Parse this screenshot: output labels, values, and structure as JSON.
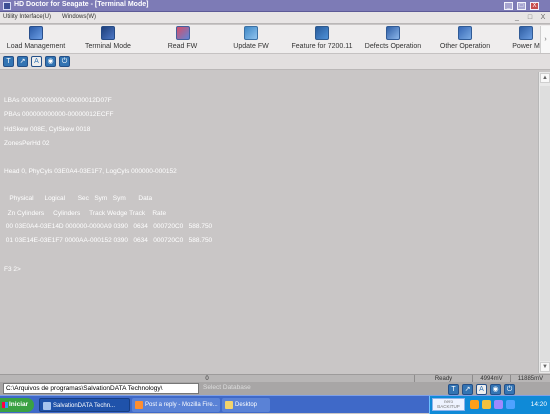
{
  "window": {
    "title": "HD Doctor for Seagate - [Terminal Mode]",
    "controls": [
      "_",
      "□",
      "X"
    ]
  },
  "menubar": {
    "items": [
      "Utility Interface(U)",
      "Windows(W)"
    ],
    "right_controls": [
      "_",
      "□",
      "X"
    ]
  },
  "toolbar": {
    "items": [
      {
        "label": "Load Management",
        "icon": "load-management-icon"
      },
      {
        "label": "Terminal Mode",
        "icon": "terminal-mode-icon"
      },
      {
        "label": "Read FW",
        "icon": "read-fw-icon"
      },
      {
        "label": "Update FW",
        "icon": "update-fw-icon"
      },
      {
        "label": "Feature for 7200.11",
        "icon": "feature-icon"
      },
      {
        "label": "Defects Operation",
        "icon": "defects-operation-icon"
      },
      {
        "label": "Other Operation",
        "icon": "other-operation-icon"
      },
      {
        "label": "Power M",
        "icon": "power-management-icon"
      }
    ],
    "scroll_arrow": "›"
  },
  "subtoolbar": {
    "buttons": [
      {
        "label": "T",
        "icon": "t-icon"
      },
      {
        "label": "↗",
        "icon": "arrow-icon"
      },
      {
        "label": "A",
        "icon": "a-icon"
      },
      {
        "label": "◉",
        "icon": "record-icon"
      },
      {
        "label": "⏻",
        "icon": "power-icon"
      }
    ]
  },
  "terminal": {
    "lines": [
      "LBAs 000000000000-00000012D07F",
      "PBAs 000000000000-00000012ECFF",
      "HdSkew 008E, CylSkew 0018",
      "ZonesPerHd 02",
      "",
      "Head 0, PhyCyls 03E0A4-03E1F7, LogCyls 000000-000152",
      "",
      "   Physical      Logical       Sec   Sym   Sym       Data",
      "  Zn Cylinders     Cylinders     Track Wedge Track    Rate",
      " 00 03E0A4-03E14D 000000-0000A9 0390   0634   000720C0   588.750",
      " 01 03E14E-03E1F7 0000AA-000152 0390   0634   000720C0   588.750",
      "",
      "F3 2>"
    ]
  },
  "scrollbar": {
    "up": "▲",
    "down": "▼"
  },
  "status": {
    "counter": "0",
    "ready": "Ready",
    "voltage_1": "4994mV",
    "voltage_2": "11885mV"
  },
  "command": {
    "path": "C:\\Arquivos de programas\\SalvationDATA Technology\\",
    "select_database": "Select Database",
    "buttons": [
      "T",
      "↗",
      "A",
      "◉",
      "⏻"
    ]
  },
  "taskbar": {
    "start": "Iniciar",
    "tasks": [
      {
        "label": "SalvationDATA Techn...",
        "icon": "app-icon"
      },
      {
        "label": "Post a reply - Mozilla Fire...",
        "icon": "firefox-icon"
      },
      {
        "label": "Desktop",
        "icon": "folder-icon"
      }
    ],
    "tray_badge": "nero\nBACKITUP",
    "clock": "14:20"
  },
  "colors": {
    "terminal_bg": "#c9c6c6",
    "title": "#7d7bb6",
    "taskbar": "#3f69c8",
    "toolbar": "#efeded"
  }
}
